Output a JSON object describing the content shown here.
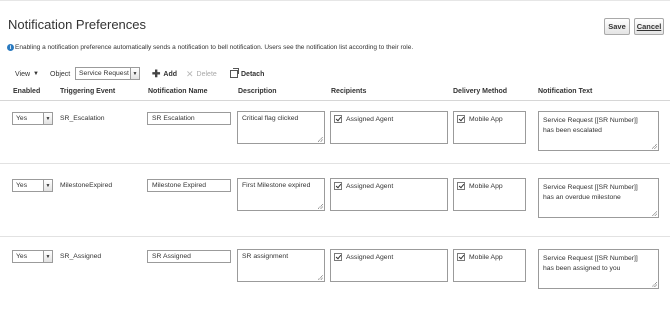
{
  "page": {
    "title": "Notification Preferences",
    "info_text": "Enabling a notification preference automatically sends a notification to bell notification. Users see the notification list according to their role."
  },
  "actions": {
    "save_label": "Save",
    "cancel_label": "Cancel"
  },
  "toolbar": {
    "view_label": "View",
    "object_label": "Object",
    "object_value": "Service Request",
    "add_label": "Add",
    "delete_label": "Delete",
    "detach_label": "Detach"
  },
  "table": {
    "headers": [
      "Enabled",
      "Triggering Event",
      "Notification Name",
      "Description",
      "Recipients",
      "Delivery Method",
      "Notification Text"
    ],
    "rows": [
      {
        "enabled": "Yes",
        "event": "SR_Escalation",
        "name": "SR Escalation",
        "description": "Critical flag clicked",
        "recipient": "Assigned Agent",
        "delivery": "Mobile App",
        "text_line1": "Service Request [[SR Number]]",
        "text_line2": "has been escalated"
      },
      {
        "enabled": "Yes",
        "event": "MilestoneExpired",
        "name": "Milestone Expired",
        "description": "First Milestone expired",
        "recipient": "Assigned Agent",
        "delivery": "Mobile App",
        "text_line1": "Service Request [[SR Number]]",
        "text_line2": "has an overdue milestone"
      },
      {
        "enabled": "Yes",
        "event": "SR_Assigned",
        "name": "SR Assigned",
        "description": "SR assignment",
        "recipient": "Assigned Agent",
        "delivery": "Mobile App",
        "text_line1": "Service Request [[SR Number]]",
        "text_line2": "has been assigned to you"
      }
    ]
  },
  "icons": {
    "info": "info-icon",
    "view_caret": "caret-down-icon",
    "dropdown": "chevron-down-icon",
    "add": "plus-icon",
    "delete": "close-icon",
    "detach": "detach-icon",
    "checkbox": "checkbox-checked-icon"
  },
  "colors": {
    "info_blue": "#2a7ac0",
    "disabled_text": "#a8a8a8",
    "border": "#9b9b9b"
  }
}
